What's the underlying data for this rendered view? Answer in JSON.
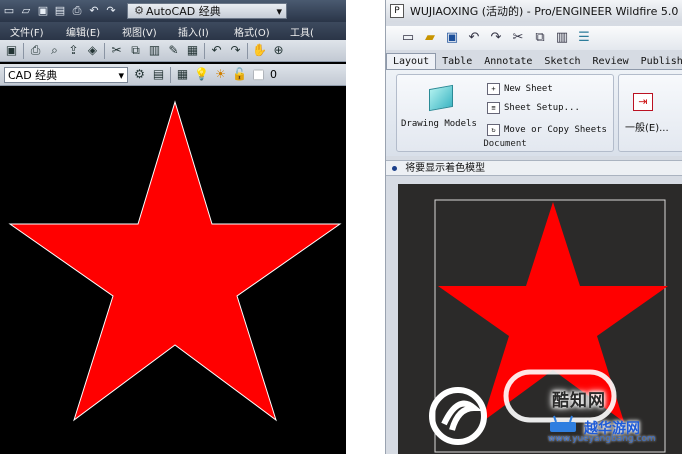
{
  "colors": {
    "star_red": "#ff0000",
    "acad_canvas": "#000000",
    "proe_canvas": "#2b2a29",
    "proe_chrome": "#d6dbe3"
  },
  "autocad": {
    "quick_access_icons": [
      "new-icon",
      "open-icon",
      "save-icon",
      "save-as-icon",
      "print-icon",
      "undo-icon",
      "redo-icon"
    ],
    "workspace_select": "AutoCAD 经典",
    "menu": [
      "文件(F)",
      "编辑(E)",
      "视图(V)",
      "插入(I)",
      "格式(O)",
      "工具("
    ],
    "standard_toolbar_icons": [
      "save-icon",
      "print-icon",
      "preview-icon",
      "publish-icon",
      "3d-icon",
      "cut-icon",
      "copy-icon",
      "paste-icon",
      "match-icon",
      "block-icon",
      "undo-icon",
      "redo-icon",
      "pan-icon",
      "zoom-icon"
    ],
    "workspace_toolbar_select": "CAD 经典",
    "layer_value": "0"
  },
  "proe": {
    "window_title": "WUJIAOXING (活动的) - Pro/ENGINEER Wildfire 5.0",
    "toolbar_icons": [
      "new-icon",
      "open-icon",
      "save-icon",
      "undo-icon",
      "redo-icon",
      "cut-icon",
      "copy-icon",
      "paste-icon",
      "layers-icon"
    ],
    "tabs": [
      "Layout",
      "Table",
      "Annotate",
      "Sketch",
      "Review",
      "Publish"
    ],
    "active_tab": "Layout",
    "ribbon": {
      "drawing_models": "Drawing Models",
      "new_sheet": "New Sheet",
      "sheet_setup": "Sheet Setup...",
      "move_copy_sheets": "Move or Copy Sheets",
      "document_group": "Document",
      "general": "一般(E)..."
    },
    "message": "将要显示着色模型"
  },
  "watermark": {
    "text": "酷知网",
    "brand": "越华游网",
    "site": "www.yueyangbang.com"
  }
}
